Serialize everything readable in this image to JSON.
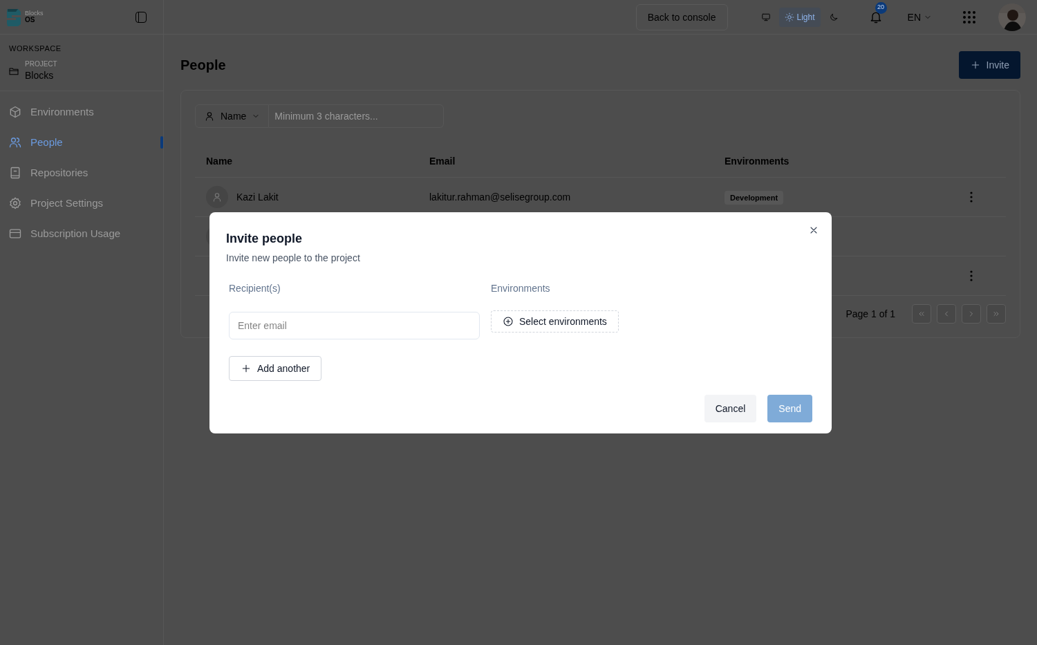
{
  "brand": {
    "line1": "Blocks",
    "line2": "OS"
  },
  "sidebar": {
    "section": "WORKSPACE",
    "project_label": "PROJECT",
    "project_name": "Blocks",
    "items": [
      {
        "label": "Environments",
        "selected": false
      },
      {
        "label": "People",
        "selected": true
      },
      {
        "label": "Repositories",
        "selected": false
      },
      {
        "label": "Project Settings",
        "selected": false
      },
      {
        "label": "Subscription Usage",
        "selected": false
      }
    ]
  },
  "header": {
    "back_button": "Back to console",
    "theme_options": [
      {
        "selected": false
      },
      {
        "label": "Light",
        "selected": true
      },
      {
        "selected": false
      }
    ],
    "notifications": "20",
    "language": "EN"
  },
  "page": {
    "title": "People",
    "invite_button": "Invite",
    "filter": {
      "field": "Name",
      "placeholder": "Minimum 3 characters..."
    },
    "table": {
      "columns": [
        "Name",
        "Email",
        "Environments"
      ],
      "rows": [
        {
          "name": "Kazi Lakit",
          "email": "lakitur.rahman@selisegroup.com",
          "environment": "Development",
          "avatar": true,
          "menu": true
        },
        {
          "avatar": true,
          "menu": false
        },
        {
          "avatar": false,
          "menu": true
        }
      ]
    },
    "pagination": "Page 1 of 1"
  },
  "dialog": {
    "title": "Invite people",
    "subtitle": "Invite new people to the project",
    "recipients_label": "Recipient(s)",
    "environments_label": "Environments",
    "email_placeholder": "Enter email",
    "select_button": "Select environments",
    "add_button": "Add another",
    "cancel_button": "Cancel",
    "send_button": "Send",
    "send_disabled": true
  }
}
